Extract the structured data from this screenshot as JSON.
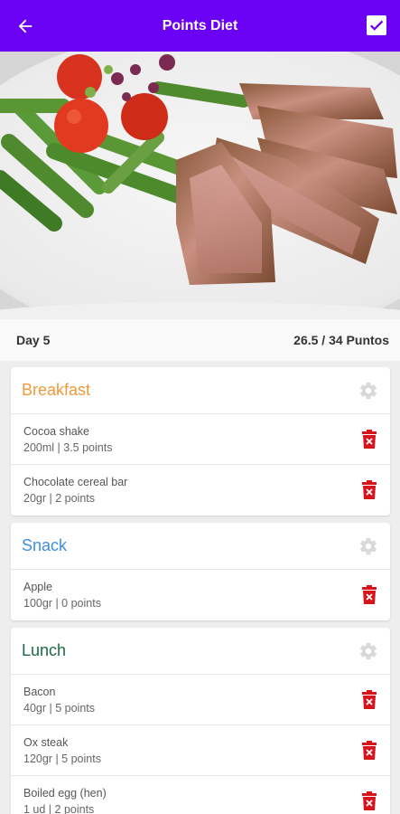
{
  "appbar": {
    "title": "Points Diet",
    "back_icon": "arrow-left-icon",
    "confirm_icon": "check-box-icon"
  },
  "hero": {
    "alt_subject": "steak-with-asparagus-and-tomatoes-photo"
  },
  "summary": {
    "day": "Day 5",
    "points": "26.5 / 34 Puntos"
  },
  "colors": {
    "primary": "#6a00f4",
    "breakfast": "#ef9a3a",
    "snack": "#3d8fe0",
    "lunch": "#1b6b45",
    "delete": "#d7141c"
  },
  "meals": [
    {
      "name": "Breakfast",
      "items": [
        {
          "name": "Cocoa shake",
          "detail": "200ml | 3.5 points"
        },
        {
          "name": "Chocolate cereal bar",
          "detail": "20gr | 2 points"
        }
      ]
    },
    {
      "name": "Snack",
      "items": [
        {
          "name": "Apple",
          "detail": "100gr | 0 points"
        }
      ]
    },
    {
      "name": "Lunch",
      "items": [
        {
          "name": "Bacon",
          "detail": "40gr | 5 points"
        },
        {
          "name": "Ox steak",
          "detail": "120gr | 5 points"
        },
        {
          "name": "Boiled egg (hen)",
          "detail": "1 ud | 2 points"
        }
      ]
    }
  ]
}
